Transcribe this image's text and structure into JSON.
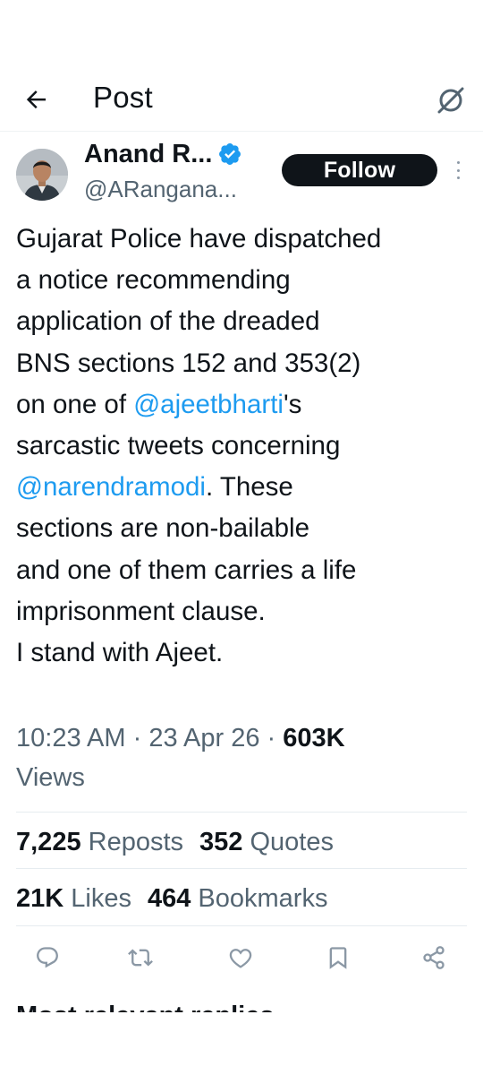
{
  "header": {
    "title": "Post",
    "back_icon": "arrow-left-icon",
    "grok_icon": "grok-icon"
  },
  "author": {
    "name": "Anand R...",
    "handle": "@ARangana...",
    "verified_color": "#1d9bf0",
    "follow_label": "Follow"
  },
  "tweet": {
    "lines": [
      [
        {
          "t": "Gujarat Police have dispatched"
        }
      ],
      [
        {
          "t": "a notice recommending"
        }
      ],
      [
        {
          "t": "application of the dreaded"
        }
      ],
      [
        {
          "t": "BNS sections 152 and 353(2)"
        }
      ],
      [
        {
          "t": "on one of "
        },
        {
          "t": "@ajeetbharti",
          "mention": true
        },
        {
          "t": "'s"
        }
      ],
      [
        {
          "t": "sarcastic tweets concerning"
        }
      ],
      [
        {
          "t": "@narendramodi",
          "mention": true
        },
        {
          "t": ". These"
        }
      ],
      [
        {
          "t": "sections are non-bailable"
        }
      ],
      [
        {
          "t": "and one of them carries a life"
        }
      ],
      [
        {
          "t": "imprisonment clause."
        }
      ],
      [
        {
          "t": " "
        }
      ],
      [
        {
          "t": "I stand with Ajeet."
        }
      ]
    ]
  },
  "meta": {
    "time": "10:23 AM",
    "separator": "·",
    "date": "23 Apr 26",
    "views_count": "603K",
    "views_label": "Views"
  },
  "stats": {
    "reposts_count": "7,225",
    "reposts_label": "Reposts",
    "quotes_count": "352",
    "quotes_label": "Quotes",
    "likes_count": "21K",
    "likes_label": "Likes",
    "bookmarks_count": "464",
    "bookmarks_label": "Bookmarks"
  },
  "actions": [
    "reply-icon",
    "repost-icon",
    "like-icon",
    "bookmark-icon",
    "share-icon"
  ],
  "colors": {
    "accent": "#1d9bf0",
    "text": "#0f1419",
    "secondary": "#536471",
    "icon": "#8b98a5"
  },
  "replies_header": "Most relevant replies"
}
